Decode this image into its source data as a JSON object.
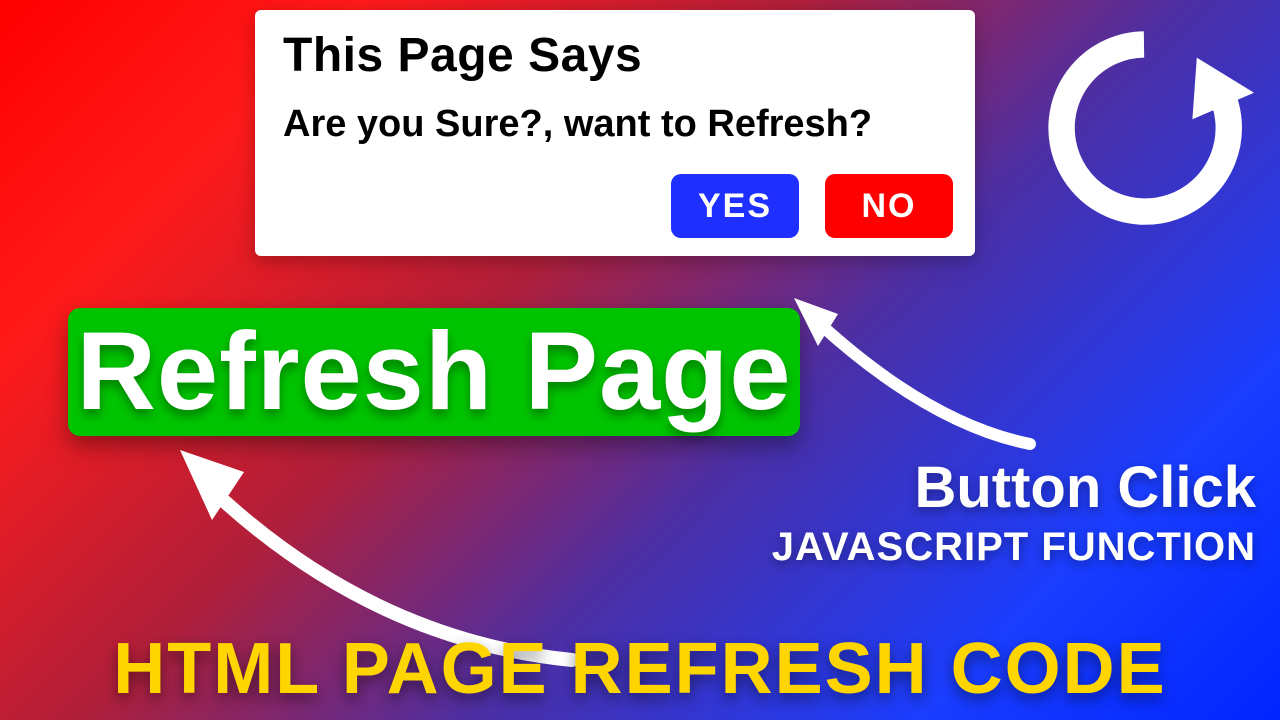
{
  "dialog": {
    "title": "This Page Says",
    "message": "Are you Sure?, want to Refresh?",
    "yes_label": "YES",
    "no_label": "NO"
  },
  "main_button": {
    "label": "Refresh Page"
  },
  "annotations": {
    "button_click": "Button Click",
    "js_function": "JAVASCRIPT FUNCTION",
    "bottom_title": "HTML PAGE REFRESH CODE"
  },
  "colors": {
    "yes": "#1f2fff",
    "no": "#ff0000",
    "green": "#00c400",
    "yellow": "#ffd500"
  }
}
